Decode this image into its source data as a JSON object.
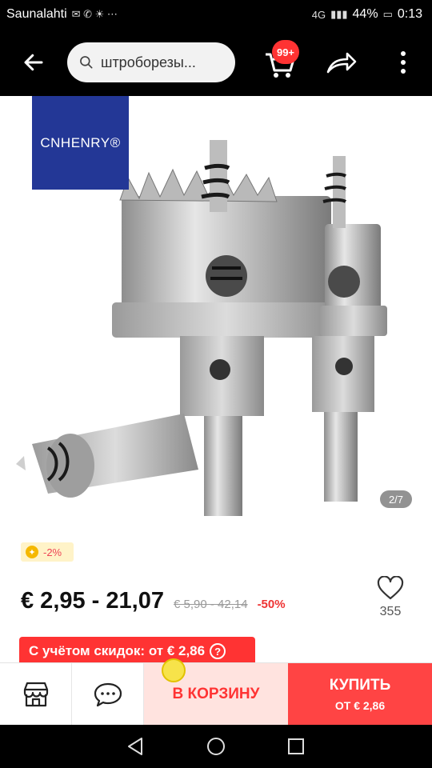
{
  "status_bar": {
    "carrier": "Saunalahti",
    "network": "4G",
    "battery": "44%",
    "time": "0:13"
  },
  "header": {
    "search_text": "штроборезы...",
    "cart_badge": "99+",
    "icons": [
      "back-arrow-icon",
      "search-icon",
      "cart-icon",
      "share-icon",
      "more-icon"
    ]
  },
  "gallery": {
    "brand_logo": "CNHENRY®",
    "counter": "2/7"
  },
  "product": {
    "discount_chip": "-2%",
    "price": "€ 2,95 - 21,07",
    "old_price": "€ 5,90 - 42,14",
    "discount_pct": "-50%",
    "wishlist_count": "355",
    "coupon_text": "С учётом скидок: от € 2,86",
    "coupon_help": "?"
  },
  "bottom_bar": {
    "add_to_cart": "В КОРЗИНУ",
    "buy_label": "КУПИТЬ",
    "buy_sub": "ОТ € 2,86",
    "icons": [
      "store-icon",
      "chat-icon"
    ]
  },
  "colors": {
    "accent_red": "#ff3333",
    "brand_blue": "#233796",
    "chip_bg": "#fff3c8"
  }
}
